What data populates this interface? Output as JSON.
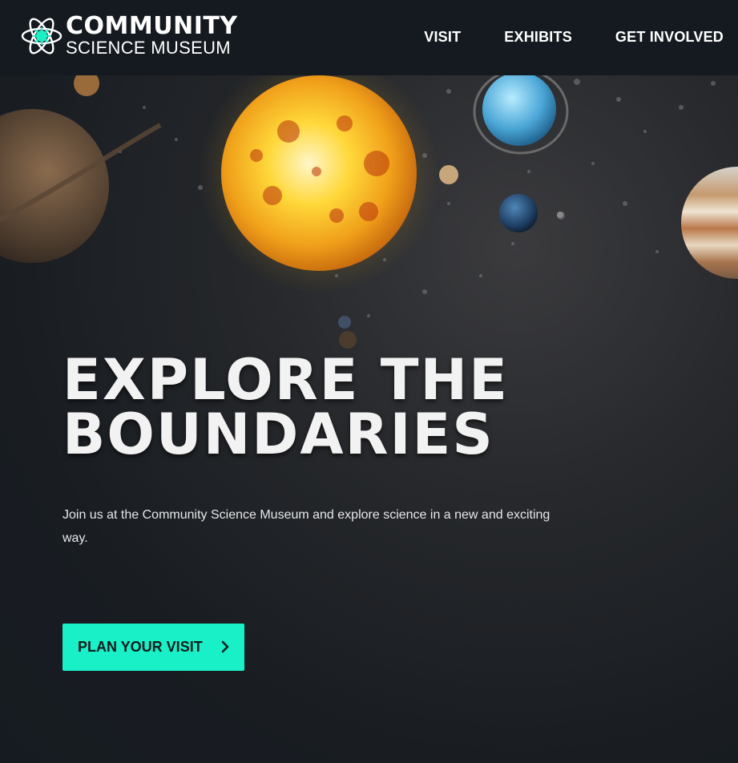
{
  "header": {
    "logo_line1": "COMMUNITY",
    "logo_line2": "SCIENCE MUSEUM",
    "logo_icon": "atom-icon",
    "nav": [
      {
        "label": "VISIT"
      },
      {
        "label": "EXHIBITS"
      },
      {
        "label": "GET INVOLVED"
      }
    ]
  },
  "hero": {
    "headline_line1": "EXPLORE THE",
    "headline_line2": "BOUNDARIES",
    "intro": "Join us at the Community Science Museum and explore science in a new and exciting way.",
    "cta_label": "PLAN YOUR VISIT",
    "cta_icon": "chevron-right-icon"
  },
  "colors": {
    "header_bg": "#141a20",
    "accent": "#19f0c8",
    "text": "#ffffff"
  }
}
